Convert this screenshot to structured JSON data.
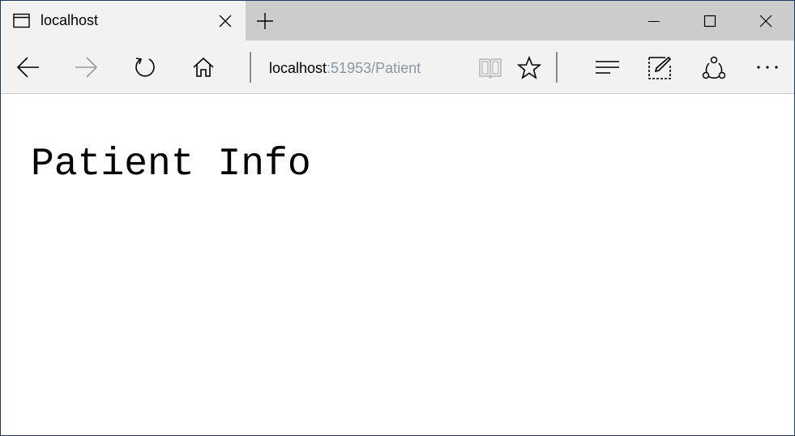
{
  "tab": {
    "title": "localhost"
  },
  "address_bar": {
    "host": "localhost",
    "path": ":51953/Patient"
  },
  "toolbar_icons": [
    "back-icon",
    "forward-icon",
    "refresh-icon",
    "home-icon",
    "reading-view-icon",
    "favorite-star-icon",
    "hub-icon",
    "web-note-icon",
    "share-icon",
    "more-icon"
  ],
  "page": {
    "heading": "Patient Info"
  },
  "colors": {
    "tab_active": "#f2f2f2",
    "tab_strip": "#cccccc",
    "url_path": "#8a97a2",
    "window_border": "#1e3a5c"
  }
}
